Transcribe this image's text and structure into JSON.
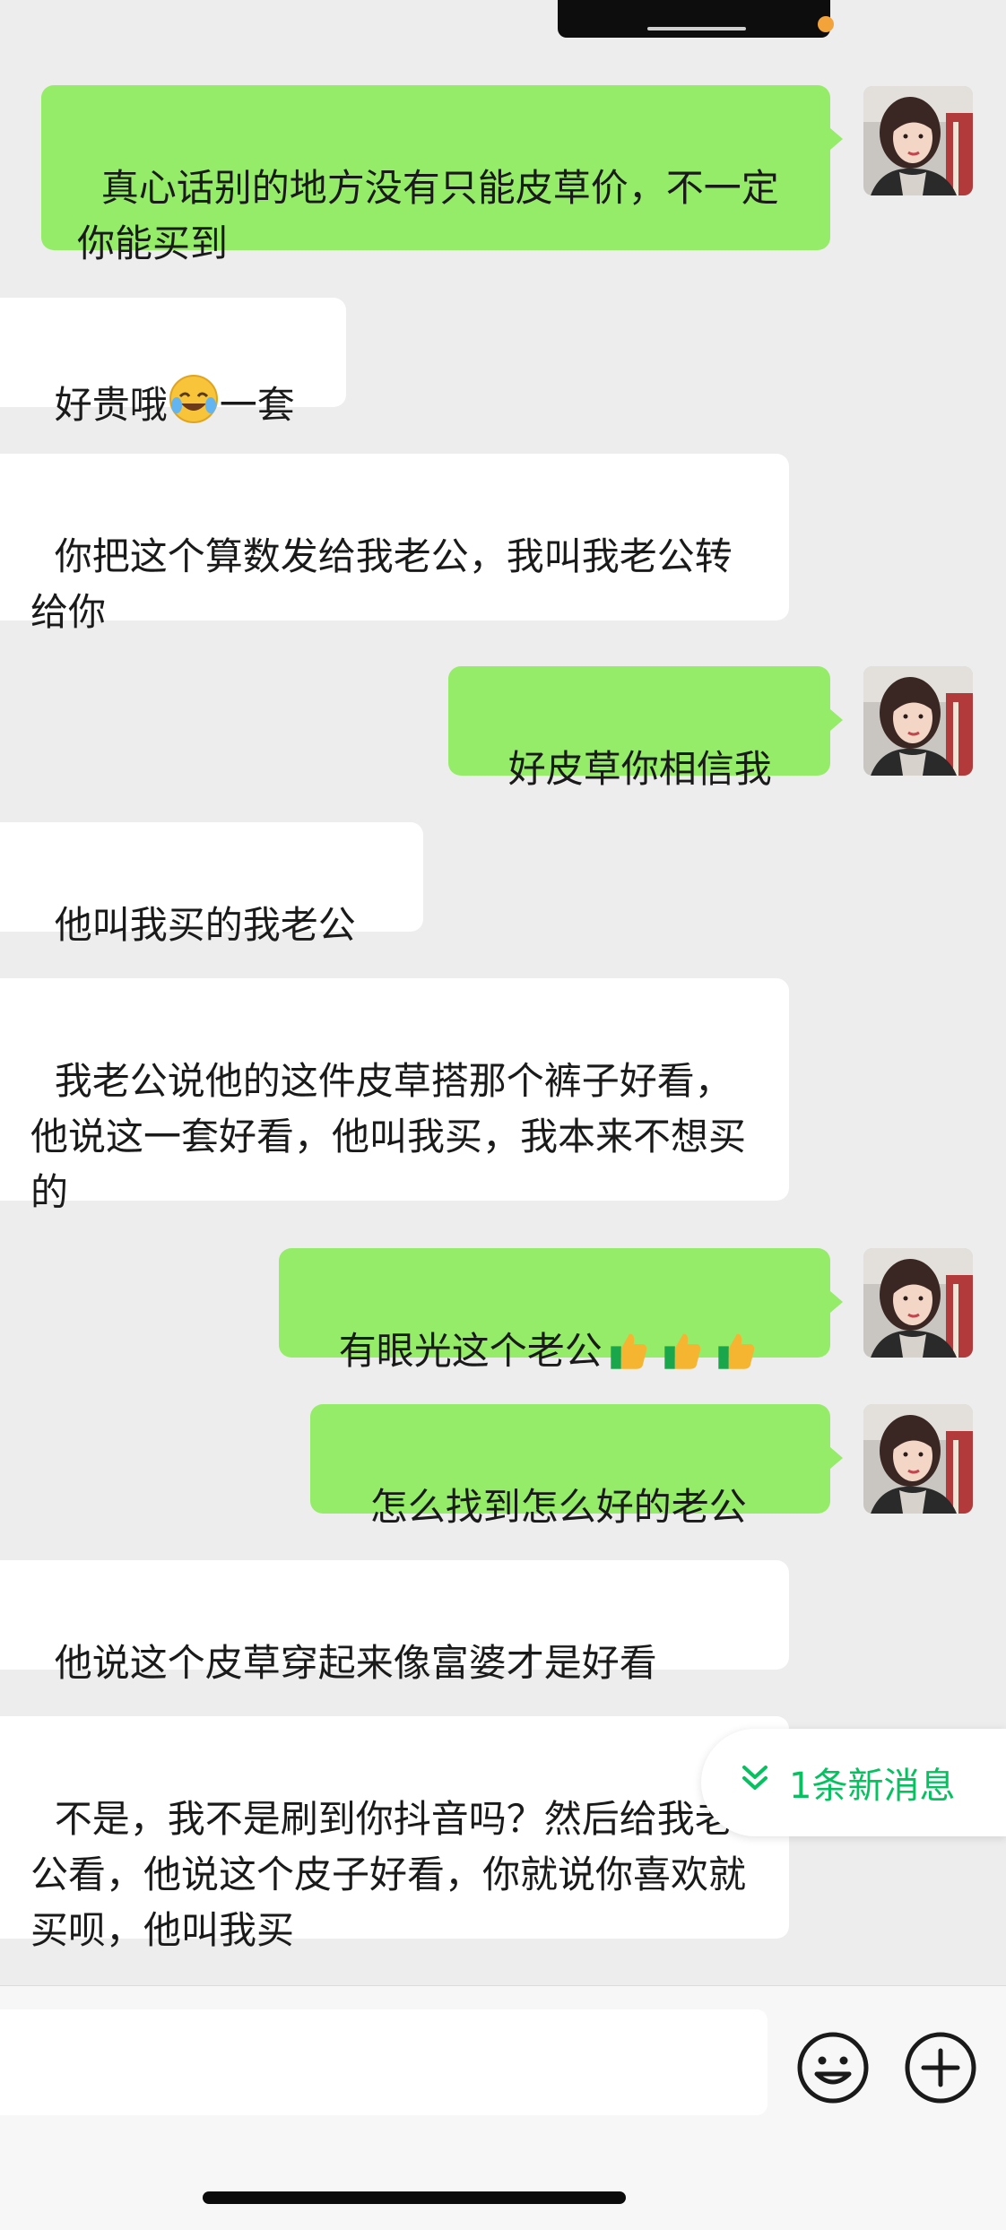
{
  "messages": [
    {
      "side": "out",
      "text": "真心话别的地方没有只能皮草价，不一定你能买到"
    },
    {
      "side": "in",
      "text_before": "好贵哦",
      "emoji": "laughing-crying-emoji",
      "text_after": "一套"
    },
    {
      "side": "in",
      "text": "你把这个算数发给我老公，我叫我老公转给你"
    },
    {
      "side": "out",
      "text": "好皮草你相信我"
    },
    {
      "side": "in",
      "text": "他叫我买的我老公"
    },
    {
      "side": "in",
      "text": "我老公说他的这件皮草搭那个裤子好看，他说这一套好看，他叫我买，我本来不想买的"
    },
    {
      "side": "out",
      "text": "有眼光这个老公",
      "emojis": [
        "thumbs-up-emoji",
        "thumbs-up-emoji",
        "thumbs-up-emoji"
      ]
    },
    {
      "side": "out",
      "text": "怎么找到怎么好的老公"
    },
    {
      "side": "in",
      "text": "他说这个皮草穿起来像富婆才是好看"
    },
    {
      "side": "in",
      "text": "不是，我不是刷到你抖音吗？然后给我老公看，他说这个皮子好看，你就说你喜欢就买呗，他叫我买"
    }
  ],
  "new_message_pill": {
    "label": "1条新消息",
    "icon": "double-chevron-down-icon"
  },
  "input_bar": {
    "placeholder": "",
    "icons": [
      "emoji-icon",
      "plus-icon"
    ]
  },
  "colors": {
    "outgoing": "#95ec69",
    "incoming": "#ffffff",
    "background": "#ededed",
    "accent": "#07c160"
  }
}
